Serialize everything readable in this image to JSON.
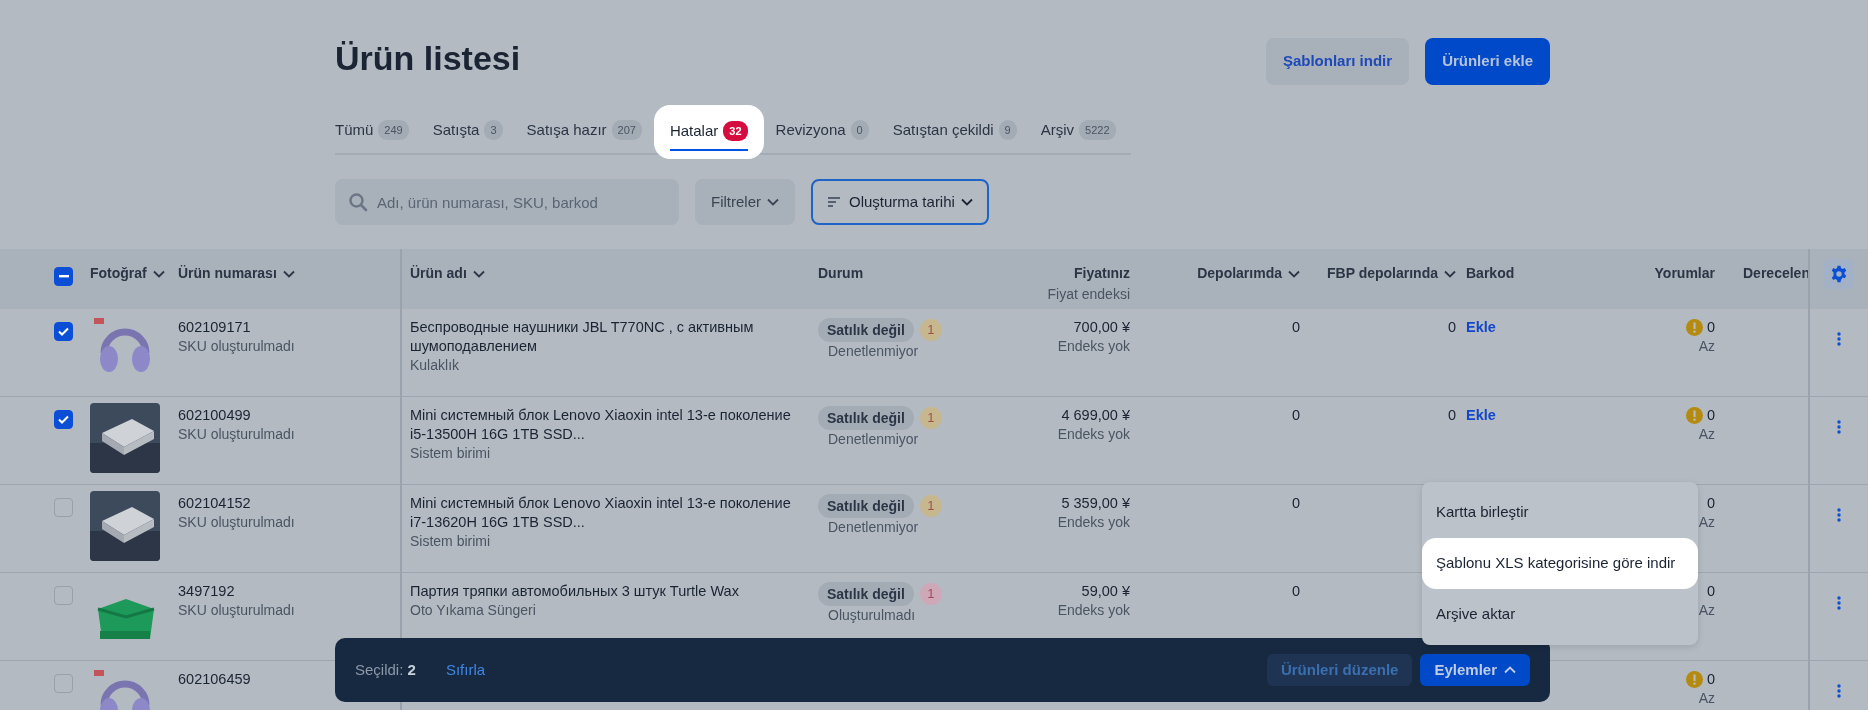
{
  "page": {
    "title": "Ürün listesi"
  },
  "header_buttons": [
    {
      "label": "Şablonları indir",
      "kind": "secondary"
    },
    {
      "label": "Ürünleri ekle",
      "kind": "primary"
    }
  ],
  "tabs": [
    {
      "label": "Tümü",
      "count": "249",
      "selected": false
    },
    {
      "label": "Satışta",
      "count": "3",
      "selected": false
    },
    {
      "label": "Satışa hazır",
      "count": "207",
      "selected": false
    },
    {
      "label": "Hatalar",
      "count": "32",
      "selected": true
    },
    {
      "label": "Revizyona",
      "count": "0",
      "selected": false
    },
    {
      "label": "Satıştan çekildi",
      "count": "9",
      "selected": false
    },
    {
      "label": "Arşiv",
      "count": "5222",
      "selected": false
    }
  ],
  "search": {
    "placeholder": "Adı, ürün numarası, SKU, barkod"
  },
  "filters": {
    "label": "Filtreler"
  },
  "sort": {
    "label": "Oluşturma tarihi"
  },
  "table": {
    "select_all": {
      "indeterminate": true
    },
    "columns": [
      {
        "label": "Fotoğraf",
        "sortable": true
      },
      {
        "label": "Ürün numarası",
        "sortable": true
      },
      {
        "label": "Ürün adı",
        "sortable": true
      },
      {
        "label": "Durum",
        "sortable": false
      },
      {
        "label": "Fiyatınız",
        "sublabel": "Fiyat endeksi",
        "sortable": false
      },
      {
        "label": "Depolarımda",
        "sortable": true
      },
      {
        "label": "FBP depolarında",
        "sortable": true
      },
      {
        "label": "Barkod",
        "sortable": false
      },
      {
        "label": "Yorumlar",
        "sortable": false
      },
      {
        "label": "Derecelen",
        "sortable": false
      }
    ],
    "rows": [
      {
        "checked": true,
        "number": "602109171",
        "sku": "SKU oluşturulmadı",
        "name": "Беспроводные наушники JBL T770NC , с активным шумоподавлением",
        "category": "Kulaklık",
        "status": "Satılık değil",
        "issues": "1",
        "color": "#c7b78f",
        "substatus": "Denetlenmiyor",
        "price": "700,00 ¥",
        "price_index": "Endeks yok",
        "stock": "0",
        "fbp_stock": "0",
        "barcode": "Ekle",
        "reviews": "0",
        "reviews_level": "Az",
        "reviews_warning": true
      },
      {
        "checked": true,
        "number": "602100499",
        "sku": "SKU oluşturulmadı",
        "name": "Mini системный блок Lenovo Xiaoxin intel 13-е поколение i5-13500H 16G 1TB SSD...",
        "category": "Sistem birimi",
        "status": "Satılık değil",
        "issues": "1",
        "color": "#c7b78f",
        "substatus": "Denetlenmiyor",
        "price": "4 699,00 ¥",
        "price_index": "Endeks yok",
        "stock": "0",
        "fbp_stock": "0",
        "barcode": "Ekle",
        "reviews": "0",
        "reviews_level": "Az",
        "reviews_warning": true
      },
      {
        "checked": false,
        "number": "602104152",
        "sku": "SKU oluşturulmadı",
        "name": "Mini системный блок Lenovo Xiaoxin intel 13-е поколение i7-13620H 16G 1TB SSD...",
        "category": "Sistem birimi",
        "status": "Satılık değil",
        "issues": "1",
        "color": "#c7b78f",
        "substatus": "Denetlenmiyor",
        "price": "5 359,00 ¥",
        "price_index": "Endeks yok",
        "stock": "0",
        "reviews": "0",
        "reviews_level": "Az",
        "reviews_warning": false
      },
      {
        "checked": false,
        "number": "3497192",
        "sku": "SKU oluşturulmadı",
        "name": "Партия тряпки автомобильных 3 штук Turtle Wax",
        "category": "Oto Yıkama Süngeri",
        "status": "Satılık değil",
        "issues": "1",
        "color": "#cfa8b8",
        "substatus": "Oluşturulmadı",
        "price": "59,00 ¥",
        "price_index": "Endeks yok",
        "stock": "0",
        "reviews": "0",
        "reviews_level": "Az",
        "reviews_warning": false
      },
      {
        "checked": false,
        "number": "602106459",
        "reviews": "0",
        "reviews_level": "Az",
        "reviews_warning": true
      }
    ]
  },
  "selection_bar": {
    "text": "Seçildi: **2**",
    "reset": "Sıfırla",
    "buttons": [
      {
        "label": "Ürünleri düzenle",
        "kind": "muted"
      },
      {
        "label": "Eylemler",
        "kind": "primary",
        "caret": true
      }
    ]
  },
  "actions_menu": {
    "items": [
      {
        "label": "Kartta birleştir",
        "selected": false
      },
      {
        "label": "Şablonu XLS kategorisine göre indir",
        "selected": true
      },
      {
        "label": "Arşive aktar",
        "selected": false
      }
    ]
  }
}
